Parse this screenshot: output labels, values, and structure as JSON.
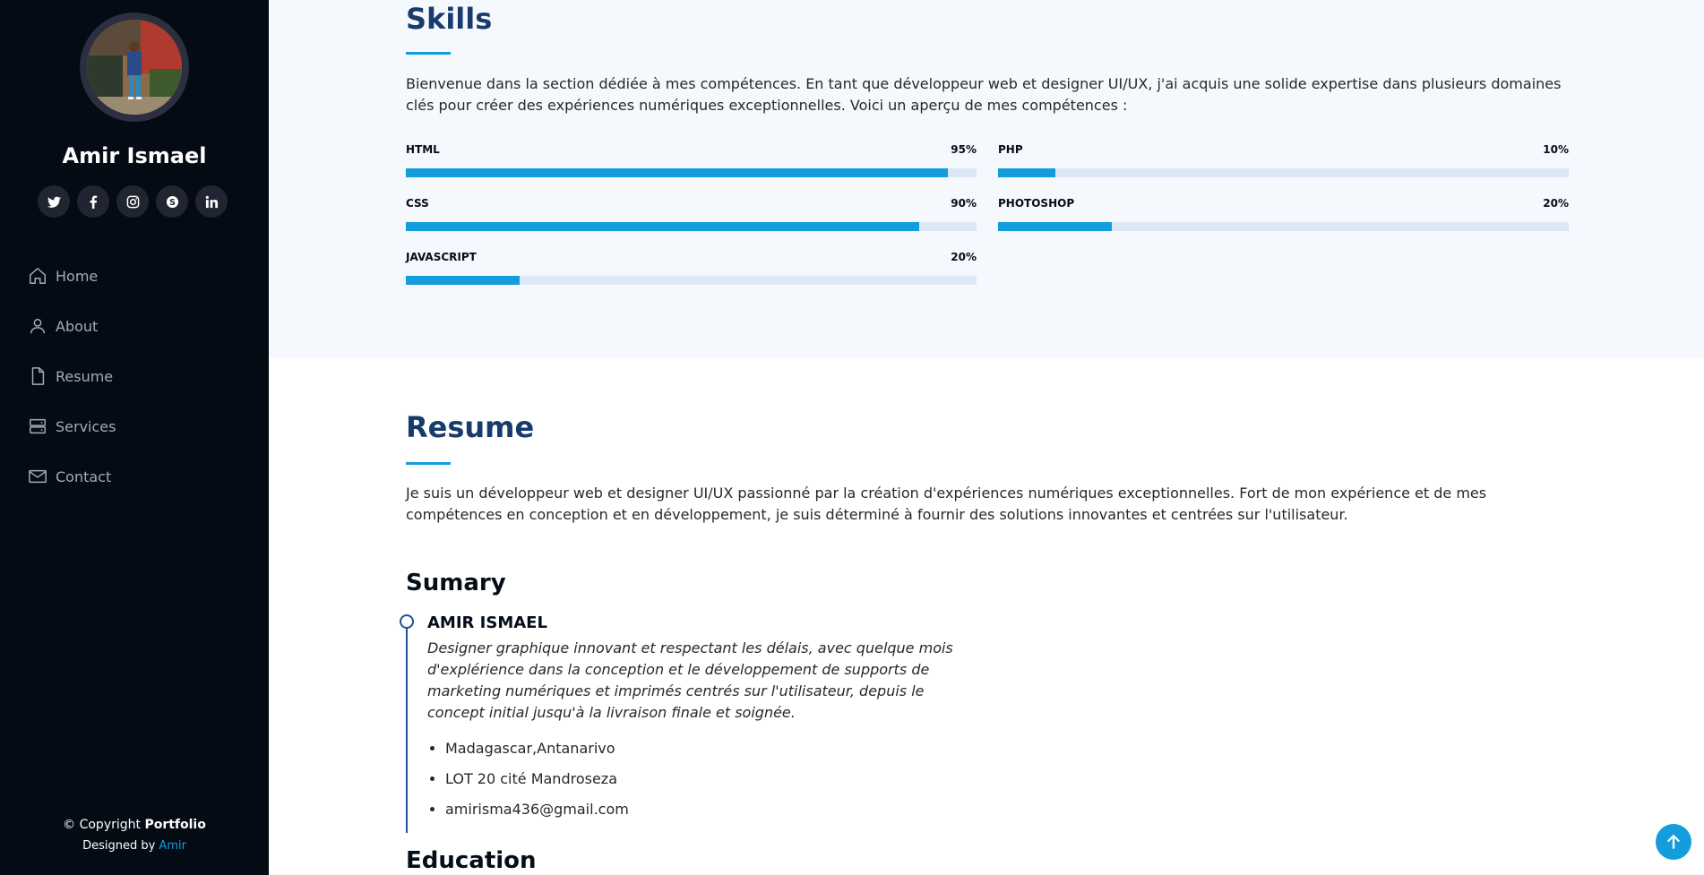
{
  "profile": {
    "name": "Amir Ismael"
  },
  "social": [
    "twitter-icon",
    "facebook-icon",
    "instagram-icon",
    "skype-icon",
    "linkedin-icon"
  ],
  "nav": [
    {
      "label": "Home",
      "icon": "home-icon"
    },
    {
      "label": "About",
      "icon": "person-icon"
    },
    {
      "label": "Resume",
      "icon": "file-icon"
    },
    {
      "label": "Services",
      "icon": "server-icon"
    },
    {
      "label": "Contact",
      "icon": "envelope-icon"
    }
  ],
  "footer": {
    "copyright_prefix": "© Copyright ",
    "brand": "Portfolio",
    "designed_prefix": "Designed by ",
    "designer": "Amir"
  },
  "skills": {
    "title": "Skills",
    "description": "Bienvenue dans la section dédiée à mes compétences. En tant que développeur web et designer UI/UX, j'ai acquis une solide expertise dans plusieurs domaines clés pour créer des expériences numériques exceptionnelles. Voici un aperçu de mes compétences :",
    "items": [
      {
        "name": "HTML",
        "value": "95%",
        "level": 0.95
      },
      {
        "name": "PHP",
        "value": "10%",
        "level": 0.1
      },
      {
        "name": "CSS",
        "value": "90%",
        "level": 0.9
      },
      {
        "name": "PHOTOSHOP",
        "value": "20%",
        "level": 0.2
      },
      {
        "name": "JAVASCRIPT",
        "value": "20%",
        "level": 0.2
      }
    ]
  },
  "resume": {
    "title": "Resume",
    "description": "Je suis un développeur web et designer UI/UX passionné par la création d'expériences numériques exceptionnelles. Fort de mon expérience et de mes compétences en conception et en développement, je suis déterminé à fournir des solutions innovantes et centrées sur l'utilisateur.",
    "summary_title": "Sumary",
    "summary": {
      "name": "AMIR ISMAEL",
      "description": "Designer graphique innovant et respectant les délais, avec quelque mois d'explérience dans la conception et le développement de supports de marketing numériques et imprimés centrés sur l'utilisateur, depuis le concept initial jusqu'à la livraison finale et soignée.",
      "details": [
        "Madagascar,Antanarivo",
        "LOT 20 cité Mandroseza",
        "amirisma436@gmail.com"
      ]
    },
    "education_title": "Education"
  },
  "colors": {
    "sidebar_bg": "#040b14",
    "accent": "#149ddd",
    "title": "#173b6c",
    "skills_bg": "#f5f8fd"
  }
}
